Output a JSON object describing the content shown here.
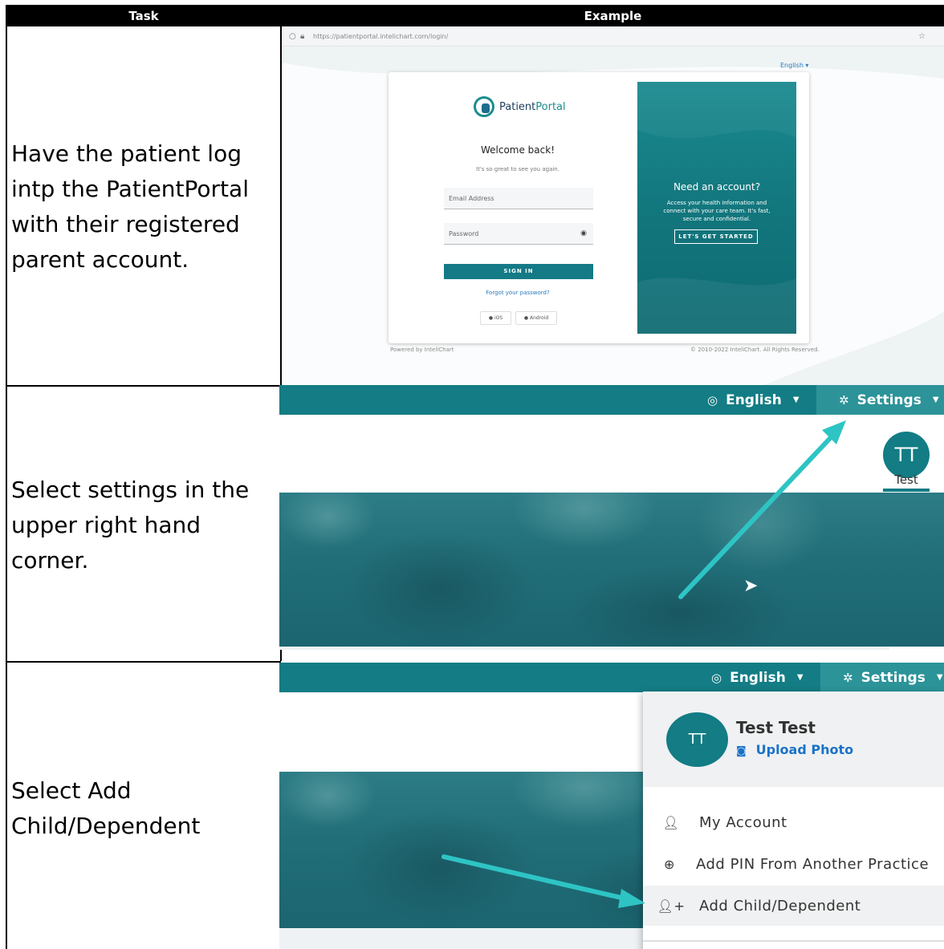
{
  "table": {
    "header_task": "Task",
    "header_example": "Example"
  },
  "rows": [
    {
      "task": "Have the patient log\nintp the PatientPortal\nwith their registered\nparent account."
    },
    {
      "task": "Select settings in the\nupper right hand\ncorner."
    },
    {
      "task": "Select Add\nChild/Dependent"
    }
  ],
  "login_shot": {
    "url": "https://patientportal.intelichart.com/login/",
    "language": "English",
    "logo_prefix": "Patient",
    "logo_suffix": "Portal",
    "welcome": "Welcome back!",
    "subtitle": "It's so great to see you again.",
    "email_placeholder": "Email Address",
    "password_placeholder": "Password",
    "sign_in": "SIGN IN",
    "forgot": "Forgot your password?",
    "ios": "iOS",
    "android": "Android",
    "panel_title": "Need an account?",
    "panel_body": "Access your health information and connect with your care team. It's fast, secure and confidential.",
    "panel_button": "LET'S GET STARTED",
    "powered_by": "Powered by InteliChart",
    "copyright": "© 2010-2022 InteliChart. All Rights Reserved."
  },
  "settings_shot": {
    "language": "English",
    "settings": "Settings",
    "avatar_initials": "TT",
    "avatar_name": "Test"
  },
  "menu_shot": {
    "language": "English",
    "settings": "Settings",
    "avatar_initials": "TT",
    "user_name": "Test Test",
    "upload_photo": "Upload Photo",
    "items": [
      {
        "label": "My Account",
        "icon": "user-gear-icon"
      },
      {
        "label": "Add PIN From Another Practice",
        "icon": "plus-circle-icon"
      },
      {
        "label": "Add Child/Dependent",
        "icon": "user-plus-icon"
      }
    ]
  },
  "colors": {
    "teal": "#137c84",
    "arrow": "#2ec4c4",
    "link": "#1a73c8"
  }
}
